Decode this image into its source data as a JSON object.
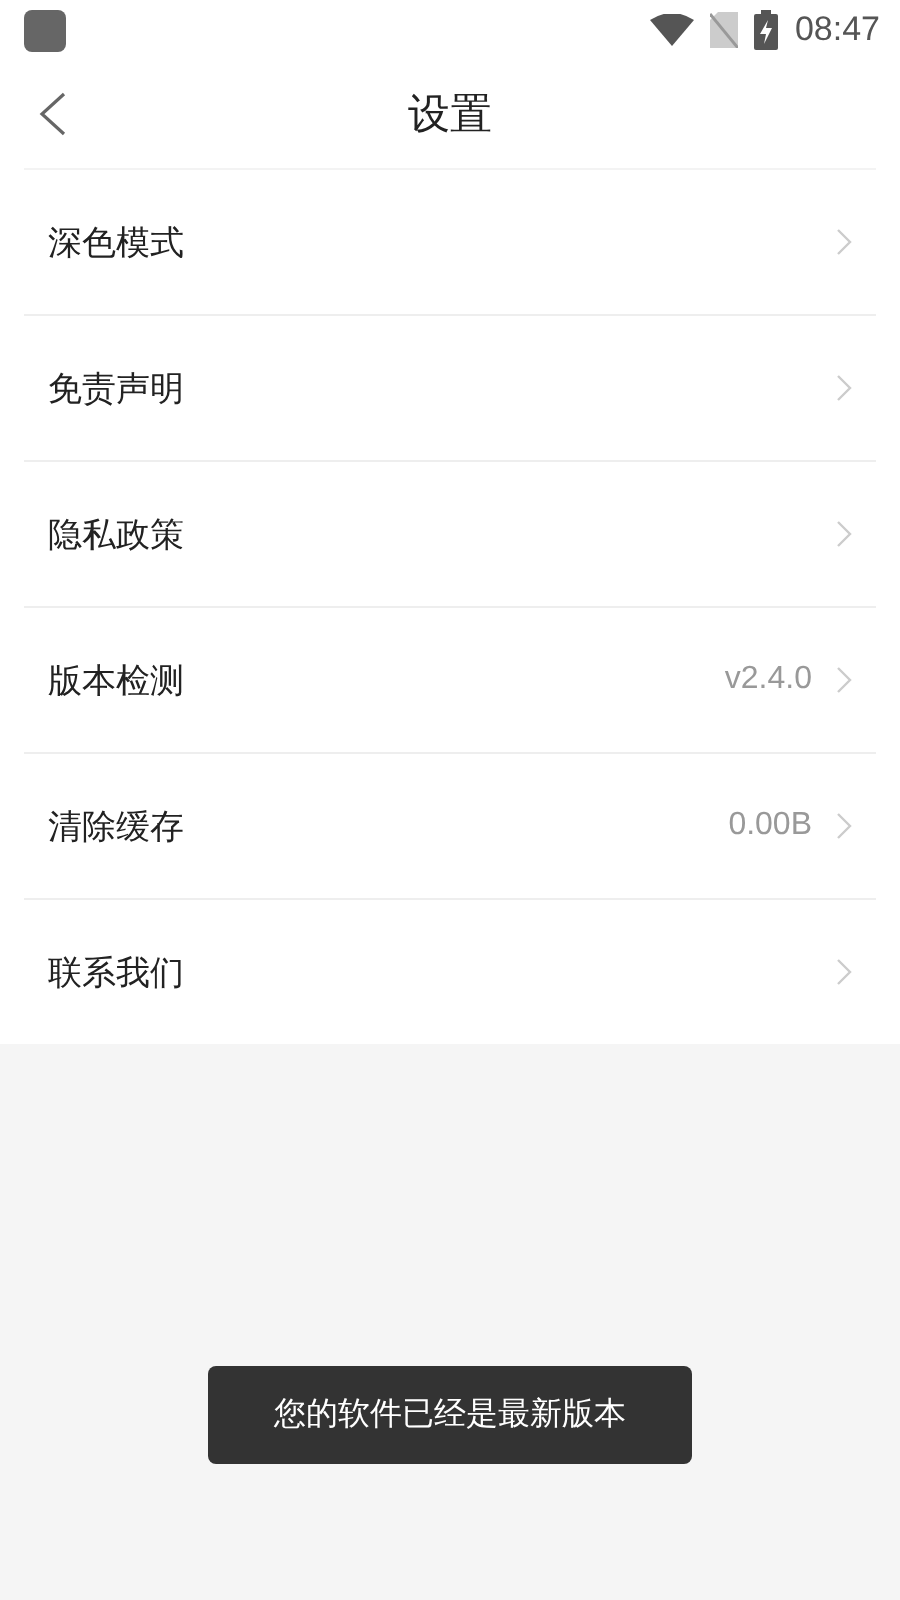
{
  "status_bar": {
    "time": "08:47"
  },
  "header": {
    "title": "设置"
  },
  "settings": [
    {
      "label": "深色模式"
    },
    {
      "label": "免责声明"
    },
    {
      "label": "隐私政策"
    },
    {
      "label": "版本检测",
      "value": "v2.4.0"
    },
    {
      "label": "清除缓存",
      "value": "0.00B"
    },
    {
      "label": "联系我们"
    }
  ],
  "toast": {
    "message": "您的软件已经是最新版本"
  }
}
